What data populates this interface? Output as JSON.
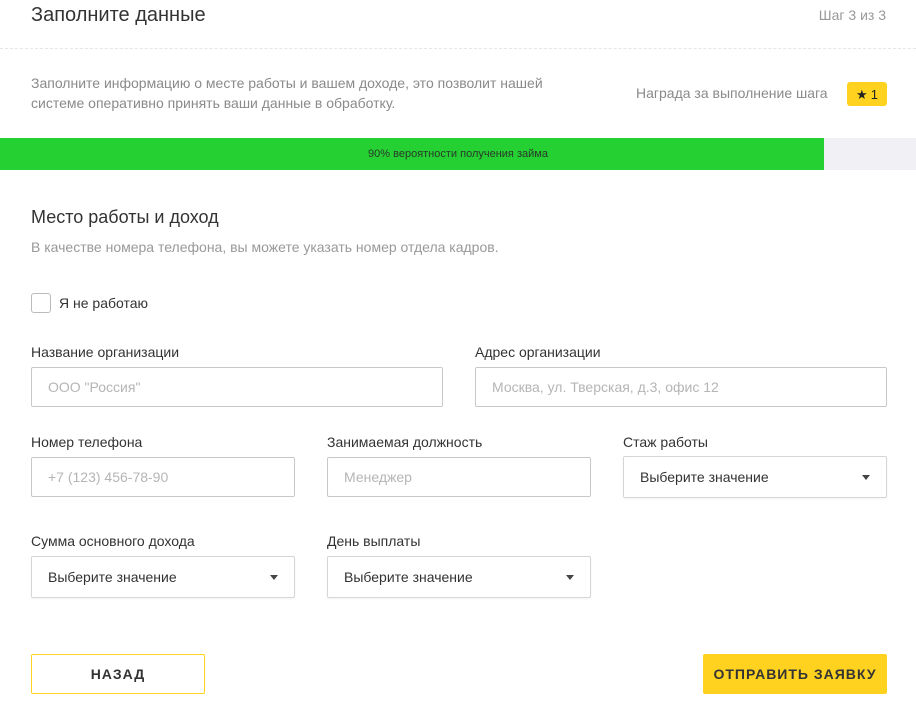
{
  "header": {
    "title": "Заполните данные",
    "step": "Шаг 3 из 3"
  },
  "intro": {
    "text": "Заполните информацию о месте работы и вашем доходе, это позволит нашей системе оперативно принять ваши данные в обработку.",
    "reward_label": "Награда за выполнение шага",
    "reward_value": "1",
    "reward_icon": "star-icon"
  },
  "progress": {
    "label": "90% вероятности получения займа",
    "value": 0.9,
    "fill_color": "#25d033"
  },
  "section": {
    "title": "Место работы и доход",
    "hint": "В качестве номера телефона, вы можете указать номер отдела кадров."
  },
  "not_working": {
    "label": "Я не работаю",
    "checked": false
  },
  "fields": {
    "org_name": {
      "label": "Название организации",
      "placeholder": "ООО \"Россия\""
    },
    "org_address": {
      "label": "Адрес организации",
      "placeholder": "Москва, ул. Тверская, д.3, офис 12"
    },
    "phone": {
      "label": "Номер телефона",
      "placeholder": "+7 (123) 456-78-90"
    },
    "position": {
      "label": "Занимаемая должность",
      "placeholder": "Менеджер"
    },
    "experience": {
      "label": "Стаж работы",
      "value": "Выберите значение"
    },
    "income": {
      "label": "Сумма основного дохода",
      "value": "Выберите значение"
    },
    "payday": {
      "label": "День выплаты",
      "value": "Выберите значение"
    }
  },
  "buttons": {
    "back": "НАЗАД",
    "submit": "ОТПРАВИТЬ ЗАЯВКУ"
  },
  "colors": {
    "accent": "#ffd21f",
    "progress": "#25d033"
  }
}
